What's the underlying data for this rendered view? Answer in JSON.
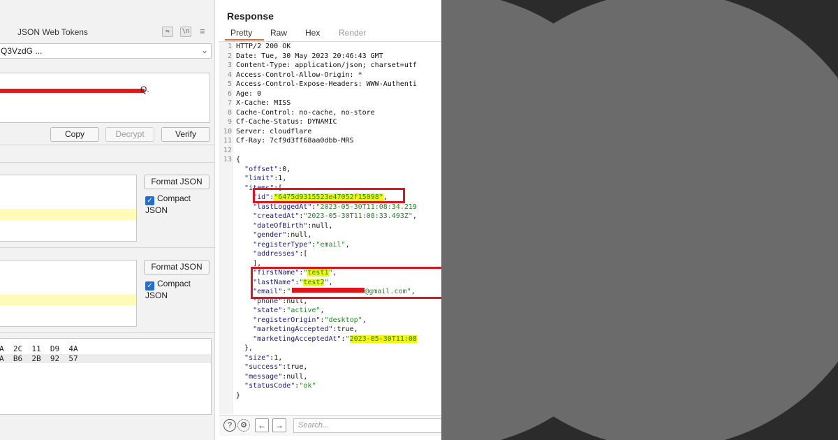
{
  "jwt_panel": {
    "title": "JSON Web Tokens",
    "toolbar_icons": [
      "wrap-icon",
      "newline-icon",
      "menu-icon"
    ],
    "wrap_icon_glyph": "⇋",
    "newline_icon_glyph": "\\n",
    "menu_glyph": "≡",
    "token_select": "Q3VzdG ...",
    "token_tail": "Q.",
    "copy_label": "Copy",
    "decrypt_label": "Decrypt",
    "verify_label": "Verify",
    "header_section": {
      "format_label": "Format JSON",
      "compact_label": "Compact JSON",
      "compact_checked": true
    },
    "payload_section": {
      "format_label": "Format JSON",
      "compact_label": "Compact JSON",
      "compact_checked": true
    },
    "hex_rows": [
      "A  2C  11  D9  4A",
      "A  B6  2B  92  57"
    ]
  },
  "response": {
    "title": "Response",
    "tabs": [
      "Pretty",
      "Raw",
      "Hex",
      "Render"
    ],
    "active_tab": "Pretty",
    "lines": [
      "HTTP/2 200 OK",
      "Date: Tue, 30 May 2023 20:46:43 GMT",
      "Content-Type: application/json; charset=utf",
      "Access-Control-Allow-Origin: *",
      "Access-Control-Expose-Headers: WWW-Authenti",
      "Age: 0",
      "X-Cache: MISS",
      "Cache-Control: no-cache, no-store",
      "Cf-Cache-Status: DYNAMIC",
      "Server: cloudflare",
      "Cf-Ray: 7cf9d3ff68aa0dbb-MRS",
      "",
      "{"
    ],
    "json_body": {
      "offset": "0",
      "limit": "1",
      "items_key": "items",
      "id": "6475d9315523e47052f15098",
      "lastLoggedAt": "2023-05-30T11:08:34.219",
      "createdAt": "2023-05-30T11:08:33.493Z",
      "dateOfBirth": "null",
      "gender": "null",
      "registerType": "email",
      "addresses": "[",
      "addresses_close": "],",
      "firstName": "test1",
      "lastName": "test2",
      "email_suffix": "@gmail.com",
      "phone": "null",
      "state": "active",
      "registerOrigin": "desktop",
      "marketingAccepted": "true",
      "marketingAcceptedAt": "2023-05-30T11:08",
      "size": "1",
      "success": "true",
      "message": "null",
      "statusCode": "ok"
    },
    "search_placeholder": "Search..."
  },
  "colors": {
    "accent_tab": "#e06a2c",
    "redaction": "#e2141b",
    "highlight": "#f4f60e",
    "checkbox": "#1e6fd0"
  }
}
